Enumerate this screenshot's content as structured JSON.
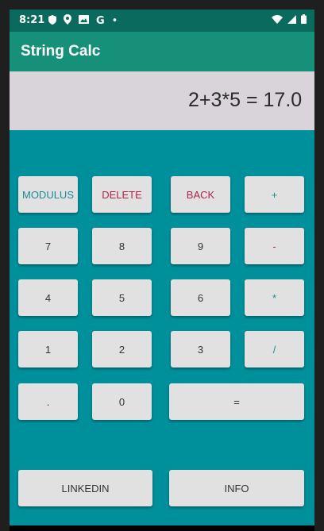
{
  "status_bar": {
    "time": "8:21",
    "dot": "•",
    "google_letter": "G"
  },
  "app_bar": {
    "title": "String Calc"
  },
  "display": {
    "expression": "2+3*5 = 17.0"
  },
  "buttons": {
    "modulus": "MODULUS",
    "delete": "DELETE",
    "back": "BACK",
    "plus": "+",
    "seven": "7",
    "eight": "8",
    "nine": "9",
    "minus": "-",
    "four": "4",
    "five": "5",
    "six": "6",
    "multiply": "*",
    "one": "1",
    "two": "2",
    "three": "3",
    "divide": "/",
    "dot": ".",
    "zero": "0",
    "equals": "=",
    "linkedin": "LINKEDIN",
    "info": "INFO"
  },
  "colors": {
    "background": "#00909b",
    "status_bar": "#0b6a5e",
    "app_bar": "#17907a",
    "display": "#d8d4d9",
    "button": "#e1e1e1",
    "teal_text": "#1e8a96",
    "red_text": "#b6234d"
  },
  "icons": [
    "shield-icon",
    "location-pin-icon",
    "gallery-icon",
    "wifi-icon",
    "signal-icon",
    "battery-icon"
  ]
}
